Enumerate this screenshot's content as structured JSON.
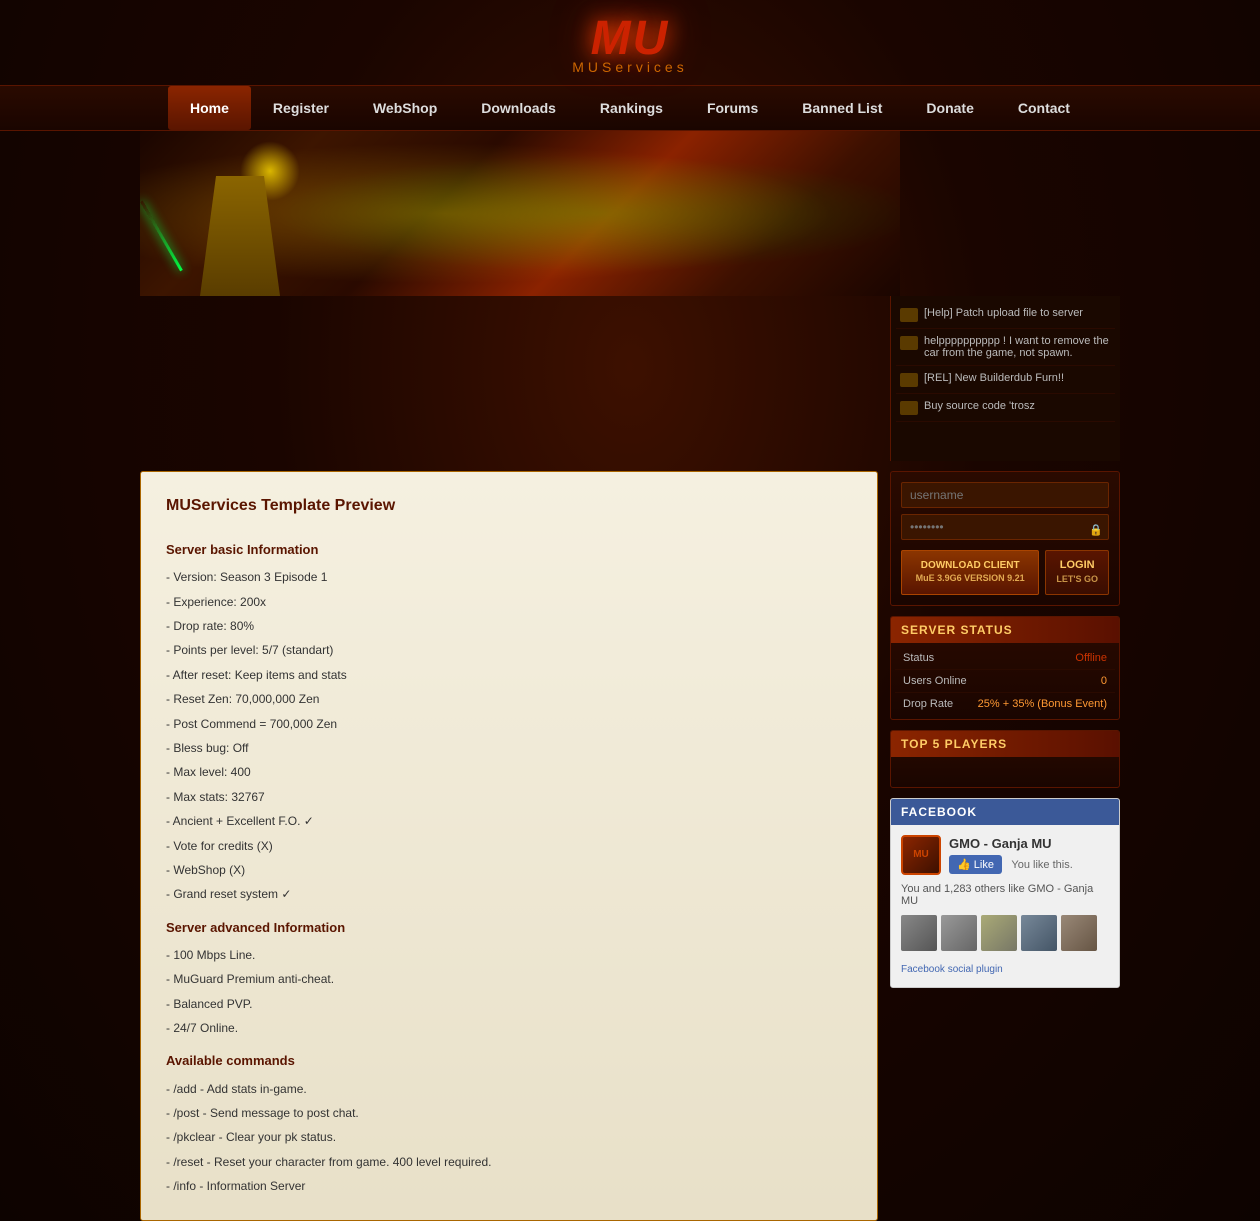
{
  "site": {
    "logo": "MU",
    "subtitle": "MUServices"
  },
  "nav": {
    "items": [
      {
        "label": "Home",
        "active": true
      },
      {
        "label": "Register",
        "active": false
      },
      {
        "label": "WebShop",
        "active": false
      },
      {
        "label": "Downloads",
        "active": false
      },
      {
        "label": "Rankings",
        "active": false
      },
      {
        "label": "Forums",
        "active": false
      },
      {
        "label": "Banned List",
        "active": false
      },
      {
        "label": "Donate",
        "active": false
      },
      {
        "label": "Contact",
        "active": false
      }
    ]
  },
  "forum_posts": [
    {
      "text": "[Help] Patch upload file to server"
    },
    {
      "text": "helpppppppppp ! I want to remove the car from the game, not spawn."
    },
    {
      "text": "[REL] New Builderdub Furn!!"
    },
    {
      "text": "Buy source code 'trosz"
    }
  ],
  "login": {
    "username_placeholder": "username",
    "password_placeholder": "••••••••",
    "download_label_line1": "DOWNLOAD CLIENT",
    "download_label_line2": "MuE 3.9G6 VERSION 9.21",
    "login_label": "LOGIN",
    "login_sub": "LET'S GO"
  },
  "server_status": {
    "title": "SERVER STATUS",
    "rows": [
      {
        "label": "Status",
        "value": "Offline",
        "type": "offline"
      },
      {
        "label": "Users Online",
        "value": "0",
        "type": "normal"
      },
      {
        "label": "Drop Rate",
        "value": "25% + 35% (Bonus Event)",
        "type": "normal"
      }
    ]
  },
  "top_players": {
    "title": "TOP 5 PLAYERS"
  },
  "facebook": {
    "title": "FACEBOOK",
    "page_name": "GMO - Ganja MU",
    "like_button": "Like",
    "like_text": "You like this.",
    "friends_text": "You and 1,283 others like GMO - Ganja MU",
    "plugin_text": "Facebook social plugin"
  },
  "main_content": {
    "title": "MUServices Template Preview",
    "section1_title": "Server basic Information",
    "lines1": [
      "- Version: Season 3 Episode 1",
      "- Experience: 200x",
      "- Drop rate: 80%",
      "- Points per level: 5/7 (standart)",
      "- After reset: Keep items and stats",
      "- Reset Zen: 70,000,000 Zen",
      "- Post Commend = 700,000 Zen",
      "- Bless bug: Off",
      "- Max level: 400",
      "- Max stats: 32767",
      "- Ancient + Excellent F.O. ✓",
      "- Vote for credits (X)",
      "- WebShop (X)",
      "- Grand reset system ✓"
    ],
    "section2_title": "Server advanced Information",
    "lines2": [
      "- 100 Mbps Line.",
      "- MuGuard Premium anti-cheat.",
      "- Balanced PVP.",
      "- 24/7 Online."
    ],
    "section3_title": "Available commands",
    "lines3": [
      "- /add - Add stats in-game.",
      "- /post - Send message to post chat.",
      "- /pkclear - Clear your pk status.",
      "- /reset - Reset your character from game. 400 level required.",
      "- /info - Information Server"
    ]
  }
}
